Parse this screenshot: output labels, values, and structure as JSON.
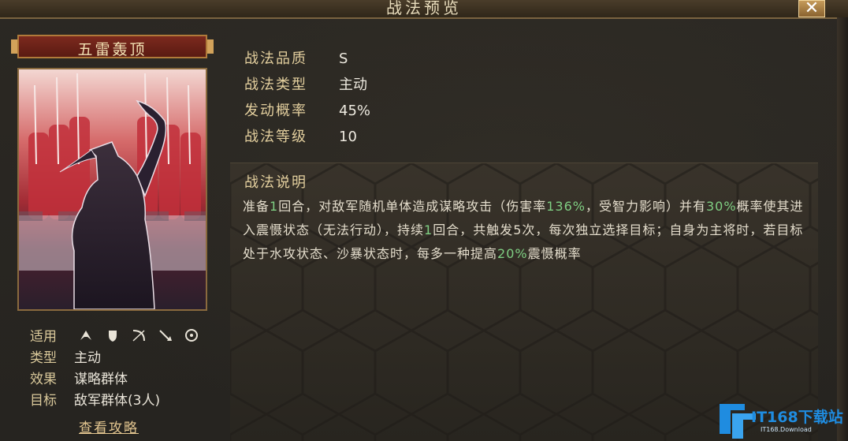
{
  "window": {
    "title": "战法预览"
  },
  "card": {
    "name": "五雷轰顶",
    "info": [
      {
        "label": "适用",
        "value": ""
      },
      {
        "label": "类型",
        "value": "主动"
      },
      {
        "label": "效果",
        "value": "谋略群体"
      },
      {
        "label": "目标",
        "value": "敌军群体(3人)"
      }
    ],
    "troop_icons": [
      "cavalry-icon",
      "shield-icon",
      "bow-icon",
      "spear-icon",
      "siege-icon"
    ],
    "guide_label": "查看攻略"
  },
  "properties": [
    {
      "label": "战法品质",
      "value": "S"
    },
    {
      "label": "战法类型",
      "value": "主动"
    },
    {
      "label": "发动概率",
      "value": "45%"
    },
    {
      "label": "战法等级",
      "value": "10"
    }
  ],
  "description": {
    "title": "战法说明",
    "segments": [
      {
        "text": "准备",
        "hl": false
      },
      {
        "text": "1",
        "hl": true
      },
      {
        "text": "回合，对敌军随机单体造成谋略攻击（伤害率",
        "hl": false
      },
      {
        "text": "136%",
        "hl": true
      },
      {
        "text": "，受智力影响）并有",
        "hl": false
      },
      {
        "text": "30%",
        "hl": true
      },
      {
        "text": "概率使其进入震慑状态（无法行动），持续",
        "hl": false
      },
      {
        "text": "1",
        "hl": true
      },
      {
        "text": "回合，共触发5次，每次独立选择目标；自身为主将时，若目标处于水攻状态、沙暴状态时，每多一种提高",
        "hl": false
      },
      {
        "text": "20%",
        "hl": true
      },
      {
        "text": "震慑概率",
        "hl": false
      }
    ]
  },
  "watermark": {
    "text": "IT168下载站",
    "sub": "IT168.Download"
  },
  "colors": {
    "highlight": "#7fcf83",
    "label_gold": "#e3cf9e",
    "card_red": "#7c2a1e"
  }
}
